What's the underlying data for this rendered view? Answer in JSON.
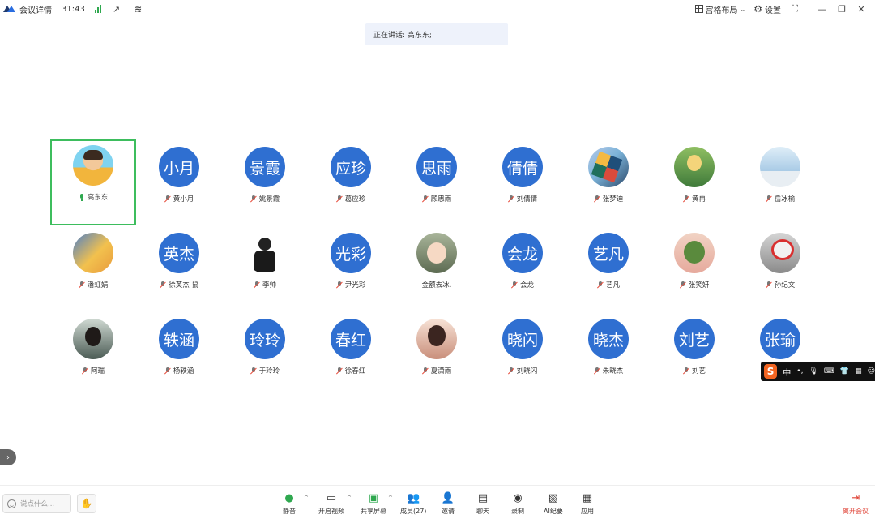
{
  "topbar": {
    "meeting_details": "会议详情",
    "timer": "31:43",
    "layout_label": "宫格布局",
    "settings_label": "设置",
    "icons": {
      "logo": "app-logo-icon",
      "signal": "signal-icon",
      "share": "share-out-icon",
      "grid": "grid-layout-icon",
      "gear": "gear-icon",
      "fullscreen": "fullscreen-icon",
      "minimize": "minimize-icon",
      "restore": "restore-icon",
      "close": "close-icon"
    }
  },
  "speaking": {
    "text": "正在讲话: 高东东;"
  },
  "participants": [
    {
      "name": "高东东",
      "avatar_type": "photo",
      "avatar_style": "p1",
      "mic": "on",
      "active": true
    },
    {
      "name": "黄小月",
      "avatar_type": "text",
      "avatar_text": "小月",
      "mic": "off"
    },
    {
      "name": "姚景霞",
      "avatar_type": "text",
      "avatar_text": "景霞",
      "mic": "off"
    },
    {
      "name": "葛应珍",
      "avatar_type": "text",
      "avatar_text": "应珍",
      "mic": "off"
    },
    {
      "name": "顾思雨",
      "avatar_type": "text",
      "avatar_text": "思雨",
      "mic": "off"
    },
    {
      "name": "刘倩倩",
      "avatar_type": "text",
      "avatar_text": "倩倩",
      "mic": "off"
    },
    {
      "name": "张梦迪",
      "avatar_type": "photo",
      "avatar_style": "p2",
      "mic": "off"
    },
    {
      "name": "黄冉",
      "avatar_type": "photo",
      "avatar_style": "p3",
      "mic": "off"
    },
    {
      "name": "岳冰榆",
      "avatar_type": "photo",
      "avatar_style": "p4",
      "mic": "off"
    },
    {
      "name": "潘虹娟",
      "avatar_type": "photo",
      "avatar_style": "p5",
      "mic": "off"
    },
    {
      "name": "徐英杰",
      "avatar_type": "text",
      "avatar_text": "英杰",
      "mic": "off",
      "extra": "鼠"
    },
    {
      "name": "李帅",
      "avatar_type": "photo",
      "avatar_style": "p6",
      "mic": "off"
    },
    {
      "name": "尹光彩",
      "avatar_type": "text",
      "avatar_text": "光彩",
      "mic": "off"
    },
    {
      "name": "金额去冰.",
      "avatar_type": "photo",
      "avatar_style": "p7",
      "mic": "none"
    },
    {
      "name": "会龙",
      "avatar_type": "text",
      "avatar_text": "会龙",
      "mic": "off"
    },
    {
      "name": "艺凡",
      "avatar_type": "text",
      "avatar_text": "艺凡",
      "mic": "off"
    },
    {
      "name": "张笑妍",
      "avatar_type": "photo",
      "avatar_style": "p8",
      "mic": "off"
    },
    {
      "name": "孙纪文",
      "avatar_type": "photo",
      "avatar_style": "p9",
      "mic": "off"
    },
    {
      "name": "阿瑞",
      "avatar_type": "photo",
      "avatar_style": "p10",
      "mic": "off"
    },
    {
      "name": "杨轶涵",
      "avatar_type": "text",
      "avatar_text": "轶涵",
      "mic": "off"
    },
    {
      "name": "于玲玲",
      "avatar_type": "text",
      "avatar_text": "玲玲",
      "mic": "off"
    },
    {
      "name": "徐春红",
      "avatar_type": "text",
      "avatar_text": "春红",
      "mic": "off"
    },
    {
      "name": "夏潇雨",
      "avatar_type": "photo",
      "avatar_style": "p11",
      "mic": "off"
    },
    {
      "name": "刘晓闪",
      "avatar_type": "text",
      "avatar_text": "晓闪",
      "mic": "off"
    },
    {
      "name": "朱晓杰",
      "avatar_type": "text",
      "avatar_text": "晓杰",
      "mic": "off"
    },
    {
      "name": "刘艺",
      "avatar_type": "text",
      "avatar_text": "刘艺",
      "mic": "off"
    },
    {
      "name": "",
      "avatar_type": "text",
      "avatar_text": "张瑜",
      "mic": "none"
    }
  ],
  "ime": {
    "logo": "S",
    "lang": "中"
  },
  "bottombar": {
    "chat_placeholder": "说点什么...",
    "tools": [
      {
        "label": "静音",
        "icon": "mic-icon"
      },
      {
        "label": "开启视频",
        "icon": "video-off-icon"
      },
      {
        "label": "共享屏幕",
        "icon": "share-screen-icon"
      },
      {
        "label": "成员(27)",
        "icon": "members-icon"
      },
      {
        "label": "邀请",
        "icon": "invite-icon"
      },
      {
        "label": "聊天",
        "icon": "chat-icon"
      },
      {
        "label": "录制",
        "icon": "record-icon"
      },
      {
        "label": "AI纪要",
        "icon": "ai-notes-icon"
      },
      {
        "label": "应用",
        "icon": "apps-icon"
      }
    ],
    "leave_label": "离开会议"
  },
  "colors": {
    "avatar_blue": "#2f6fd1",
    "active_border": "#3dbd5d",
    "leave_red": "#e0463a",
    "mic_on": "#2fa84f"
  }
}
